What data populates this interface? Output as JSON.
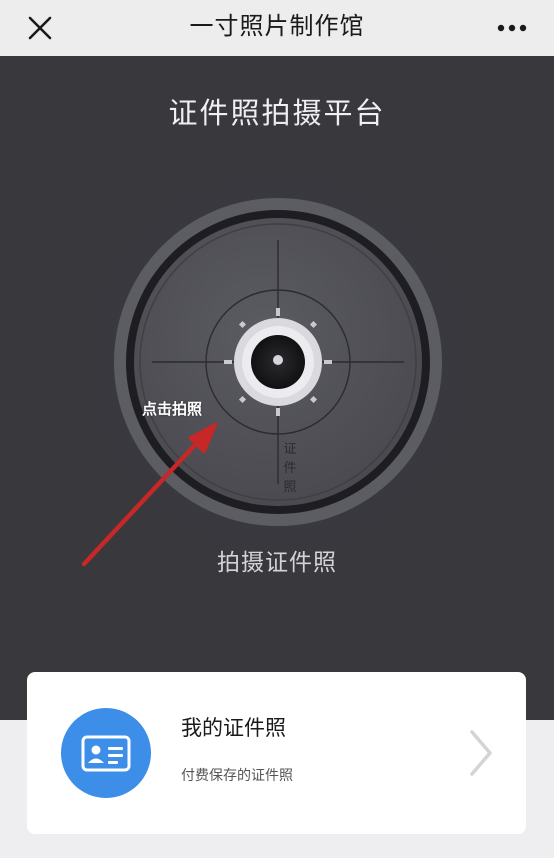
{
  "topbar": {
    "title": "一寸照片制作馆",
    "close_icon": "close-icon",
    "more_icon": "more-icon"
  },
  "main": {
    "platform_title": "证件照拍摄平台",
    "click_hint": "点击拍照",
    "dial_vertical_text": "证件照",
    "capture_label": "拍摄证件照"
  },
  "card": {
    "title": "我的证件照",
    "subtitle": "付费保存的证件照",
    "icon": "id-card-icon",
    "chevron_icon": "chevron-right-icon"
  },
  "colors": {
    "dark_panel": "#38383d",
    "accent_blue": "#3d8ee8",
    "annotation_red": "#c62828"
  }
}
